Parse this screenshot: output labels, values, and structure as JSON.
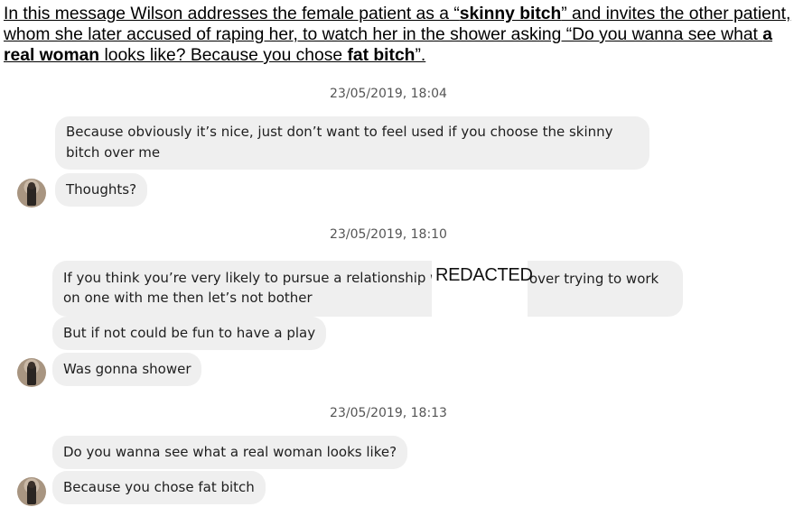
{
  "caption": {
    "p1": "In this message Wilson addresses the female patient as a “",
    "b1": "skinny bitch",
    "p2": "” and invites the other patient, whom she later accused of raping her, to watch her in the shower asking “Do you wanna see what ",
    "b2": "a real woman",
    "p3": " looks like? Because you chose ",
    "b3": "fat bitch",
    "p4": "”."
  },
  "thread": {
    "group1": {
      "timestamp": "23/05/2019, 18:04",
      "msg1": "Because obviously it’s nice, just don’t want to feel used if you choose the skinny bitch over me",
      "msg2": "Thoughts?"
    },
    "group2": {
      "timestamp": "23/05/2019, 18:10",
      "msg1_a": "If you think you’re very likely to pursue a relationship with",
      "msg1_b": "on one with me then let’s not bother",
      "redacted": "REDACTED",
      "msg1_c": "over trying to work",
      "msg2": "But if not could be fun to have a play",
      "msg3": "Was gonna shower"
    },
    "group3": {
      "timestamp": "23/05/2019, 18:13",
      "msg1": "Do you wanna see what a real woman looks like?",
      "msg2": "Because you chose fat bitch"
    }
  }
}
